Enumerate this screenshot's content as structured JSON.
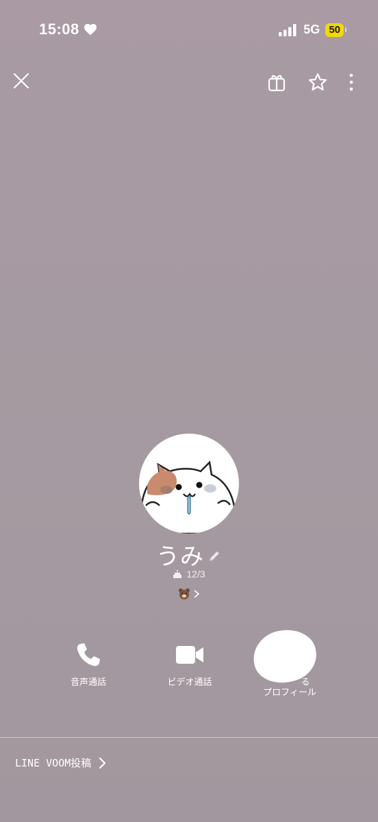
{
  "status_bar": {
    "time": "15:08",
    "network": "5G",
    "battery": "50"
  },
  "profile": {
    "name": "うみ",
    "birthday": "12/3"
  },
  "actions": {
    "voice_call": "音声通話",
    "video_call": "ビデオ通話",
    "keep_profile_line1": "る",
    "keep_profile_line2": "プロフィール"
  },
  "voom": {
    "label": "LINE VOOM投稿"
  },
  "colors": {
    "background": "#a99aa3",
    "battery_badge": "#f4d900",
    "text": "#ffffff"
  },
  "icons": {
    "close": "close-icon",
    "gift": "gift-icon",
    "favorite": "star-icon",
    "more": "more-vertical-icon",
    "edit": "pencil-icon",
    "birthday": "cake-icon",
    "decoration": "bear-icon",
    "voice_call": "phone-icon",
    "video_call": "video-camera-icon",
    "voom": "chevron-right-icon"
  }
}
